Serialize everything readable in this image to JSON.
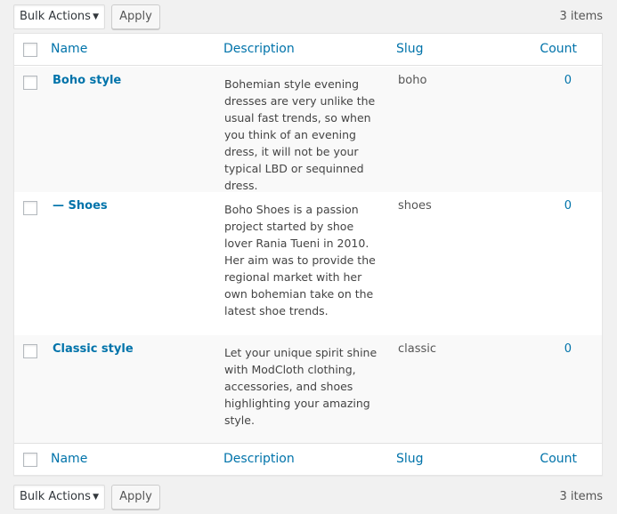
{
  "toolbar": {
    "bulk_actions": "Bulk Actions",
    "apply": "Apply",
    "items_count": "3 items"
  },
  "columns": {
    "name": "Name",
    "description": "Description",
    "slug": "Slug",
    "count": "Count"
  },
  "rows": [
    {
      "name": "Boho style",
      "description": "Bohemian style evening dresses are very unlike the usual fast trends, so when you think of an evening dress, it will not be your typical LBD or sequinned dress.",
      "slug": "boho",
      "count": "0"
    },
    {
      "name": "— Shoes",
      "description": "Boho Shoes is a passion project started by shoe lover Rania Tueni in 2010. Her aim was to provide the regional market with her own bohemian take on the latest shoe trends.",
      "slug": "shoes",
      "count": "0"
    },
    {
      "name": "Classic style",
      "description": "Let your unique spirit shine with ModCloth clothing, accessories, and shoes highlighting your amazing style.",
      "slug": "classic",
      "count": "0"
    }
  ]
}
